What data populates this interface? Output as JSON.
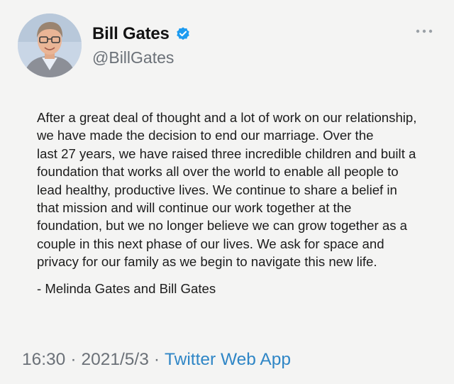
{
  "user": {
    "display_name": "Bill Gates",
    "handle": "@BillGates",
    "verified": true
  },
  "tweet": {
    "lines": [
      "After a great deal of thought and a lot of work on our relationship,",
      "we have made the decision to end our marriage. Over the",
      "last 27 years, we have raised three incredible children and built a",
      "foundation that works all over the world to enable all people to",
      "lead healthy, productive lives. We continue to share a belief in",
      "that mission and will continue our work together at the",
      "foundation, but we no longer believe we can grow together as a",
      "couple in this next phase of our lives. We ask for space and",
      "privacy for our family as we begin to navigate this new life."
    ],
    "signature": "- Melinda Gates and Bill Gates"
  },
  "meta": {
    "time": "16:30",
    "separator": "·",
    "date": "2021/5/3",
    "source": "Twitter Web App"
  },
  "icons": {
    "avatar": "profile-photo",
    "verified": "verified-badge-icon",
    "more": "more-options-icon"
  },
  "colors": {
    "background": "#f4f4f3",
    "verified_blue": "#1d9bf0",
    "link_blue": "#2f86c6",
    "secondary_text": "#6b7178"
  }
}
